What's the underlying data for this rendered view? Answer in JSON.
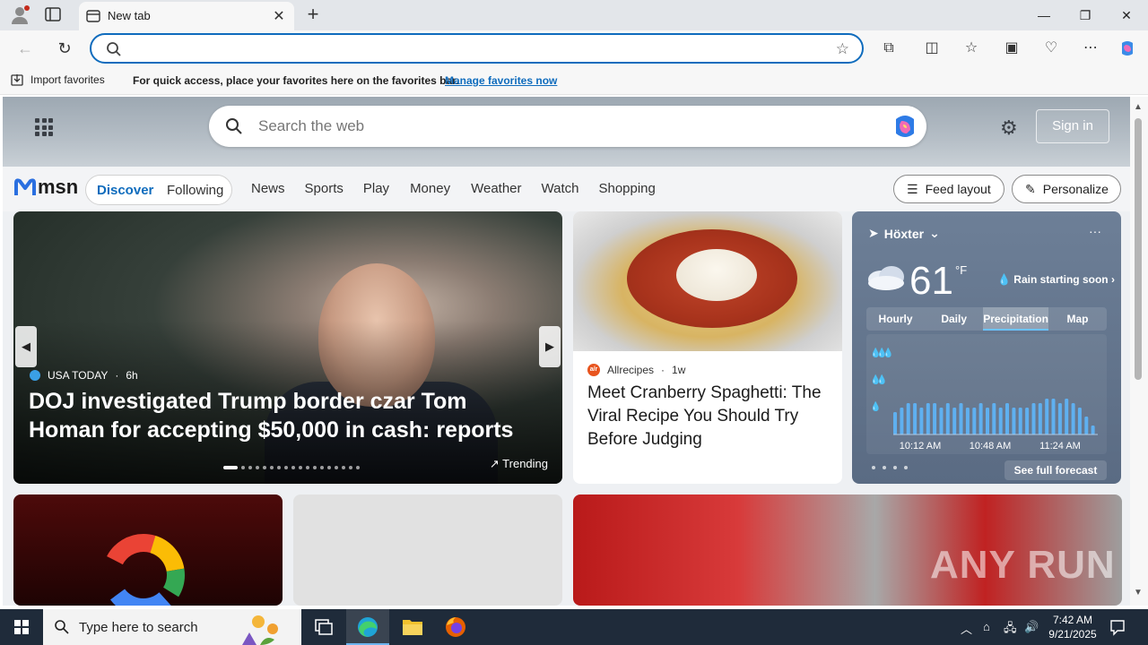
{
  "browser": {
    "tab_title": "New tab",
    "address_value": "",
    "favorites_bar": {
      "import_label": "Import favorites",
      "message": "For quick access, place your favorites here on the favorites bar.",
      "manage_link": "Manage favorites now"
    }
  },
  "msn": {
    "search_placeholder": "Search the web",
    "sign_in": "Sign in",
    "logo_text": "msn",
    "feed_tabs": [
      "Discover",
      "Following"
    ],
    "nav_links": [
      "News",
      "Sports",
      "Play",
      "Money",
      "Weather",
      "Watch",
      "Shopping"
    ],
    "feed_layout": "Feed layout",
    "personalize": "Personalize",
    "lead_story": {
      "source": "USA TODAY",
      "age": "6h",
      "title": "DOJ investigated Trump border czar Tom Homan for accepting $50,000 in cash: reports",
      "badge": "Trending",
      "slide_count": 18,
      "active_slide": 1
    },
    "food_story": {
      "source": "Allrecipes",
      "source_initials": "a/r",
      "age": "1w",
      "title": "Meet Cranberry Spaghetti: The Viral Recipe You Should Try Before Judging"
    },
    "weather": {
      "location": "Höxter",
      "temperature": "61",
      "unit": "°F",
      "alert": "Rain starting soon",
      "tabs": [
        "Hourly",
        "Daily",
        "Precipitation",
        "Map"
      ],
      "active_tab": "Precipitation",
      "times": [
        "10:12 AM",
        "10:48 AM",
        "11:24 AM"
      ],
      "see_forecast": "See full forecast",
      "precip_levels": [
        0.25,
        0.3,
        0.35,
        0.35,
        0.3,
        0.35,
        0.35,
        0.3,
        0.35,
        0.3,
        0.35,
        0.3,
        0.3,
        0.35,
        0.3,
        0.35,
        0.3,
        0.35,
        0.3,
        0.3,
        0.3,
        0.35,
        0.35,
        0.4,
        0.4,
        0.35,
        0.4,
        0.35,
        0.3,
        0.2,
        0.1
      ]
    },
    "watermark": "ANY RUN"
  },
  "taskbar": {
    "search_placeholder": "Type here to search",
    "time": "7:42 AM",
    "date": "9/21/2025"
  }
}
